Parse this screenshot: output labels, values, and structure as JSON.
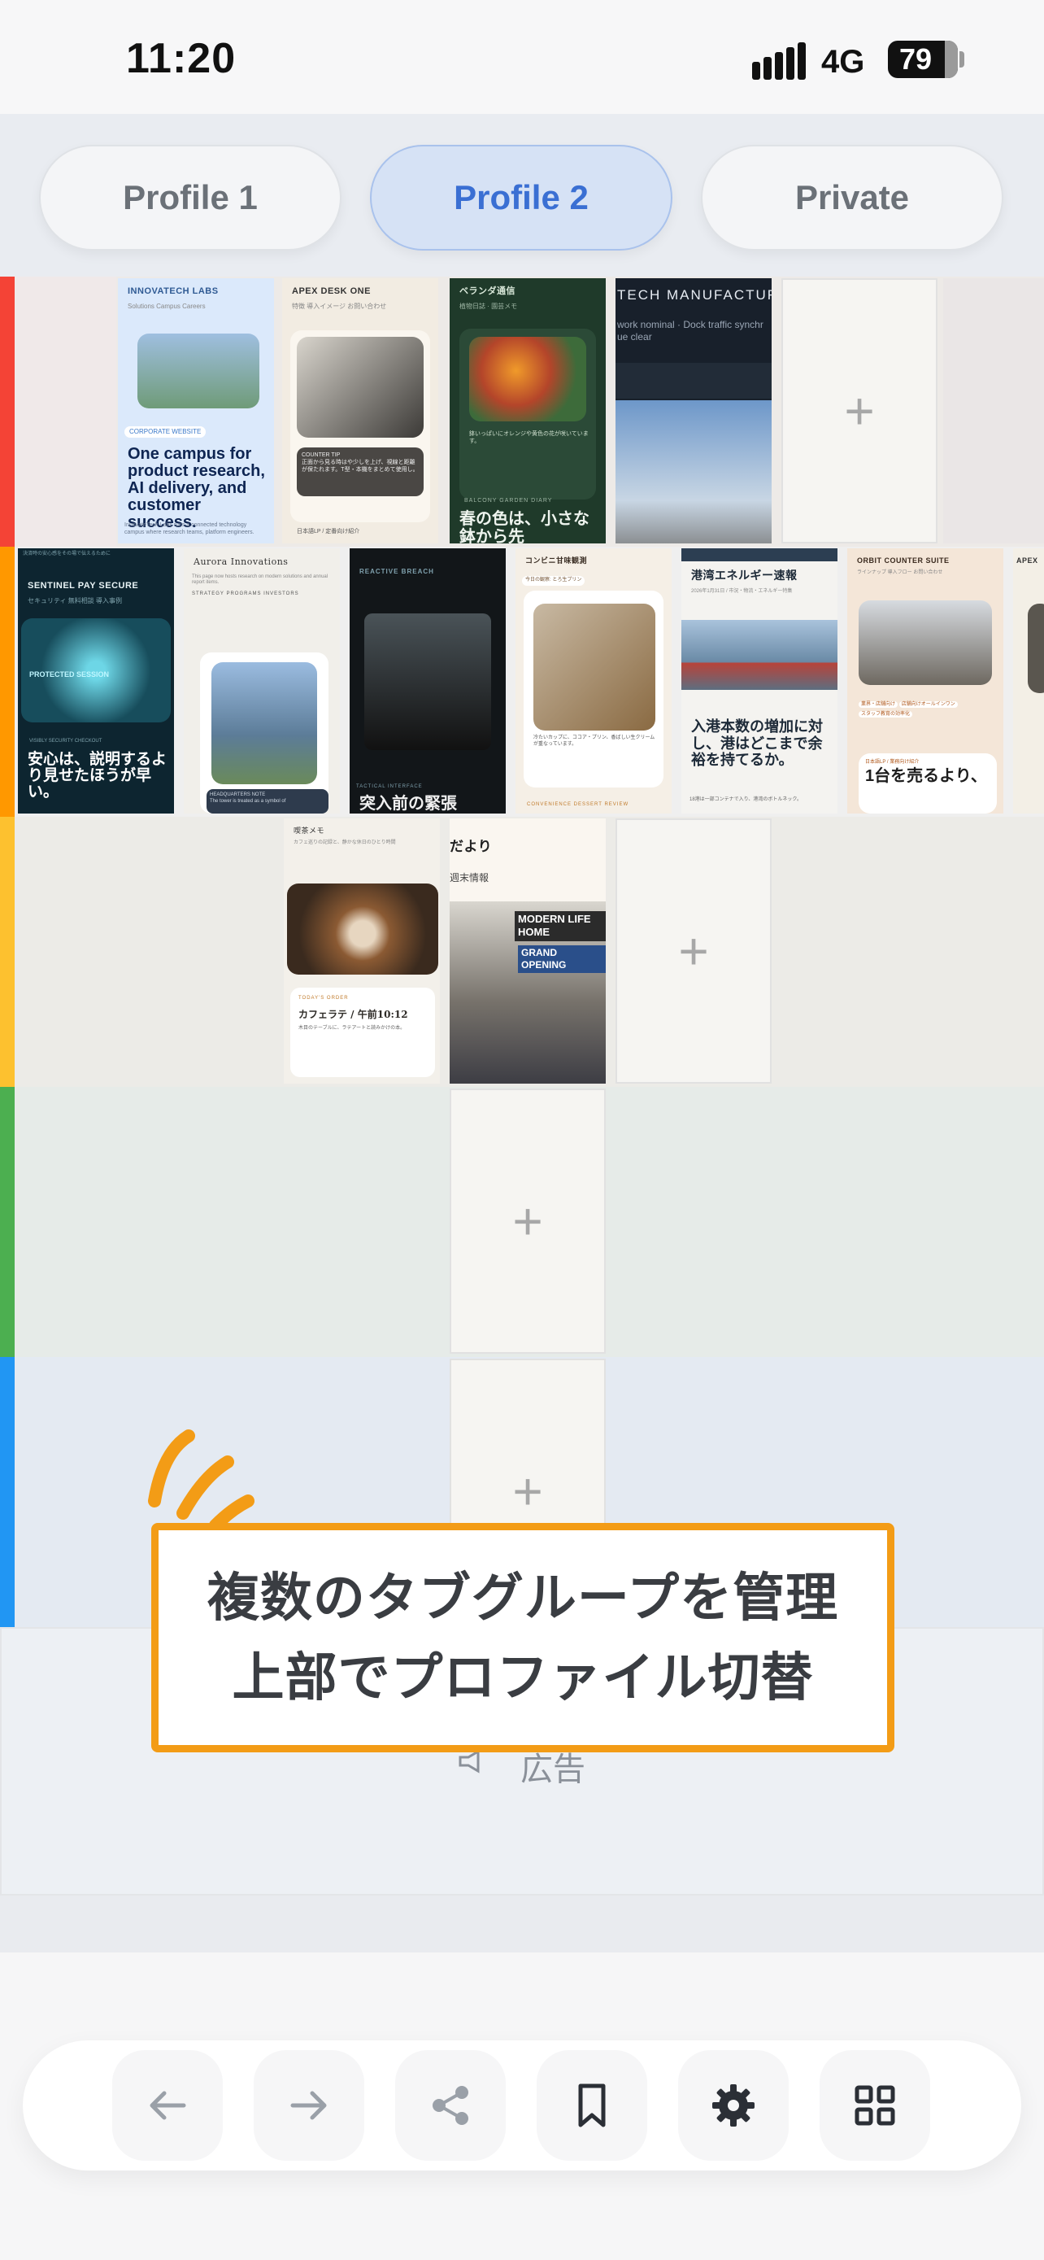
{
  "status_bar": {
    "time": "11:20",
    "network": "4G",
    "battery": "79"
  },
  "profile_tabs": [
    {
      "label": "Profile 1",
      "active": false
    },
    {
      "label": "Profile 2",
      "active": true
    },
    {
      "label": "Private",
      "active": false
    }
  ],
  "groups": [
    {
      "color": "#f44336",
      "tabs": [
        {
          "title": "INNOVATECH LABS",
          "nav": "Solutions  Campus  Careers",
          "badge": "CORPORATE WEBSITE",
          "headline": "One campus for product research, AI delivery, and customer success.",
          "body": "InnovateTech Labs runs a connected technology campus where research teams, platform engineers."
        },
        {
          "title": "APEX DESK ONE",
          "nav": "特徴  導入イメージ  お問い合わせ",
          "caption": "COUNTER TIP",
          "body": "正面から見る時はや少しを上げ、視線と距離が保たれます。T型・本機をまとめて使用し。",
          "footer": "日本語LP / 定番向け紹介"
        },
        {
          "title": "ベランダ通信",
          "nav": "植物日誌  園芸メモ  今週の庭",
          "body": "鉢いっぱいにオレンジや黄色の花が咲いています。",
          "tag": "BALCONY GARDEN DIARY",
          "headline": "春の色は、小さな鉢から先"
        },
        {
          "title": "TECH MANUFACTUR",
          "body": "work nominal · Dock traffic synchr ue clear"
        }
      ]
    },
    {
      "color": "#ff9800",
      "tabs": [
        {
          "title": "SENTINEL PAY SECURE",
          "nav": "セキュリティ  無料相談  導入事例",
          "label": "PROTECTED SESSION",
          "tag": "VISIBLY SECURITY CHECKOUT",
          "headline": "安心は、説明するより見せたほうが早い。"
        },
        {
          "title": "Aurora Innovations",
          "nav": "STRATEGY  PROGRAMS  INVESTORS",
          "body": "This page now hosts research on modern solutions and annual report items.",
          "tag": "HEADQUARTERS NOTE",
          "footer": "The tower is treated as a symbol of"
        },
        {
          "title": "REACTIVE BREACH",
          "tag": "TACTICAL INTERFACE",
          "headline": "突入前の緊張"
        },
        {
          "title": "コンビニ甘味観測",
          "chip": "今日の観察: とろ生プリン",
          "body": "冷たいカップに、ココア・プリン、香ばしい生クリームが重なっています。",
          "tag": "CONVENIENCE DESSERT REVIEW"
        },
        {
          "title": "港湾エネルギー速報",
          "nav": "2026年1月31日 / 市況・物流・エネルギー特集",
          "headline": "入港本数の増加に対し、港はどこまで余裕を持てるか。",
          "body": "18港は一部コンテナで入り、港湾のボトルネック。"
        },
        {
          "title": "ORBIT COUNTER SUITE",
          "nav": "ラインナップ  導入フロー  お問い合わせ",
          "chips": [
            "業界・店舗向け",
            "店舗向けオールインワン",
            "スタッフ教育の効率化"
          ],
          "tag": "日本語LP / 業務向け紹介",
          "headline": "1台を売るより、"
        },
        {
          "title": "APEX"
        }
      ]
    },
    {
      "color": "#fdc12f",
      "tabs": [
        {
          "title": "喫茶メモ",
          "nav": "カフェ巡りの記録と、静かな休日のひとり時間",
          "tag": "TODAY'S ORDER",
          "headline": "カフェラテ / 午前10:12",
          "body": "木目のテーブルに、ラテアートと読みかけの本。"
        },
        {
          "title": "だより",
          "nav": "週末情報",
          "sign": "MODERN LIFE HOME",
          "sign2": "GRAND OPENING"
        }
      ]
    },
    {
      "color": "#4caf50",
      "tabs": []
    },
    {
      "color": "#2196f3",
      "tabs": []
    }
  ],
  "ad": {
    "label": "広告"
  },
  "banner": {
    "line1": "複数のタブグループを管理",
    "line2": "上部でプロファイル切替"
  },
  "nav": {
    "back": "arrow-left-icon",
    "forward": "arrow-right-icon",
    "share": "share-icon",
    "bookmark": "bookmark-icon",
    "settings": "gear-icon",
    "tabs": "grid-icon"
  },
  "plus_label": "+"
}
